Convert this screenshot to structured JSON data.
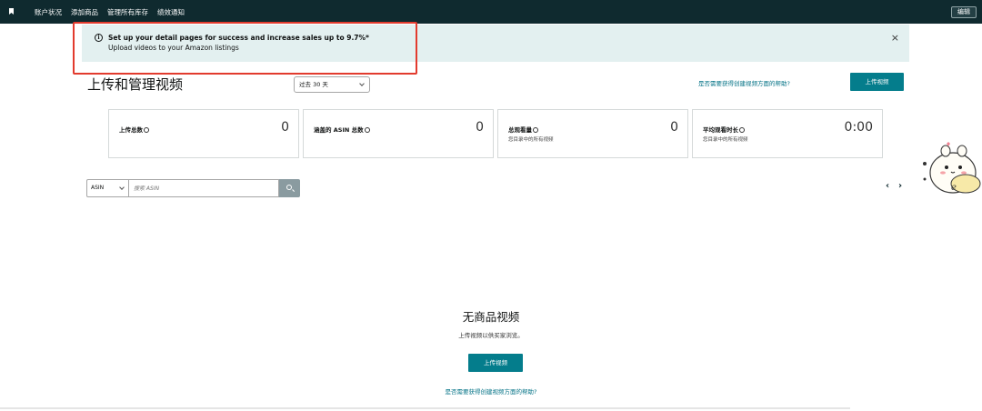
{
  "topbar": {
    "nav": [
      "账户状况",
      "添加商品",
      "管理所有库存",
      "绩效通知"
    ],
    "edit_label": "编辑"
  },
  "banner": {
    "title": "Set up your detail pages for success and increase sales up to 9.7%*",
    "subtitle": "Upload videos to your Amazon listings",
    "close": "×",
    "background": "#e3f0f0",
    "highlight_color": "#e23b2e"
  },
  "header": {
    "title": "上传和管理视频",
    "range": "过去 30 天",
    "help_link": "是否需要获得创建视频方面的帮助?",
    "upload_label": "上传视频"
  },
  "stats": [
    {
      "label": "上传总数",
      "sub": "",
      "value": "0"
    },
    {
      "label": "涵盖的 ASIN 总数",
      "sub": "",
      "value": "0"
    },
    {
      "label": "总观看量",
      "sub": "您目录中的所有视频",
      "value": "0"
    },
    {
      "label": "平均观看时长",
      "sub": "您目录中的所有视频",
      "value": "0:00"
    }
  ],
  "search": {
    "type": "ASIN",
    "placeholder": "搜索 ASIN"
  },
  "pager": {
    "prev": "‹",
    "next": "›"
  },
  "empty": {
    "title": "无商品视频",
    "subtitle": "上传视频以供买家浏览。",
    "upload_label": "上传视频",
    "help_link": "是否需要获得创建视频方面的帮助?"
  },
  "colors": {
    "topbar": "#0f2a2f",
    "accent": "#047d8c",
    "link": "#007185"
  }
}
